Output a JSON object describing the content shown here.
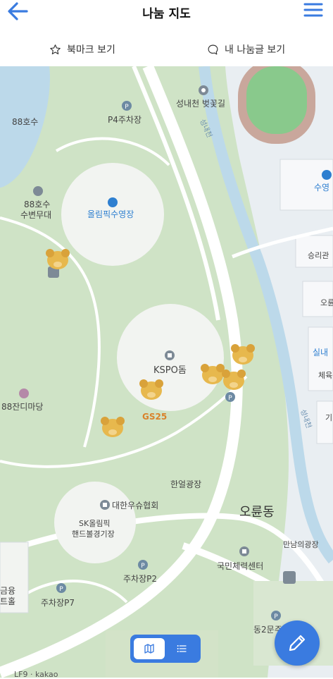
{
  "header": {
    "title": "나눔 지도",
    "bookmark_label": "북마크 보기",
    "my_posts_label": "내 나눔글 보기"
  },
  "colors": {
    "accent": "#3a7be0",
    "map_green": "#cfe3c6",
    "water": "#bcd9ea"
  },
  "icons": {
    "back": "arrow-left-icon",
    "menu": "hamburger-menu-icon",
    "bookmark": "star-outline-icon",
    "my_posts": "chat-bubble-icon",
    "map_view": "map-icon",
    "list_view": "list-icon",
    "write": "pencil-icon"
  },
  "map": {
    "labels": {
      "lake": "88호수",
      "p4": "P4주차장",
      "blossom": "성내천 벚꽃길",
      "stream_1": "성내천",
      "stream_2": "성내천",
      "stage_1": "88호수",
      "stage_2": "수변무대",
      "pool": "올림픽수영장",
      "swim": "수영",
      "winner": "승리관",
      "oryun": "오륜",
      "indoor": "실내",
      "gym": "체육",
      "ga": "기",
      "kspo": "KSPO돔",
      "gs25": "GS25",
      "field": "88잔디마당",
      "hanul": "한얼광장",
      "assoc": "대한우슈협회",
      "handball_1": "SK올림픽",
      "handball_2": "핸드볼경기장",
      "dong": "오륜동",
      "manam": "만남의광장",
      "national": "국민체력센터",
      "p2": "주차장P2",
      "p7": "주차장P7",
      "finance_1": "금융",
      "finance_2": "트홀",
      "east2": "동2문주"
    },
    "attribution": "LF9 · kakao"
  },
  "view_toggle": {
    "active": "map"
  }
}
